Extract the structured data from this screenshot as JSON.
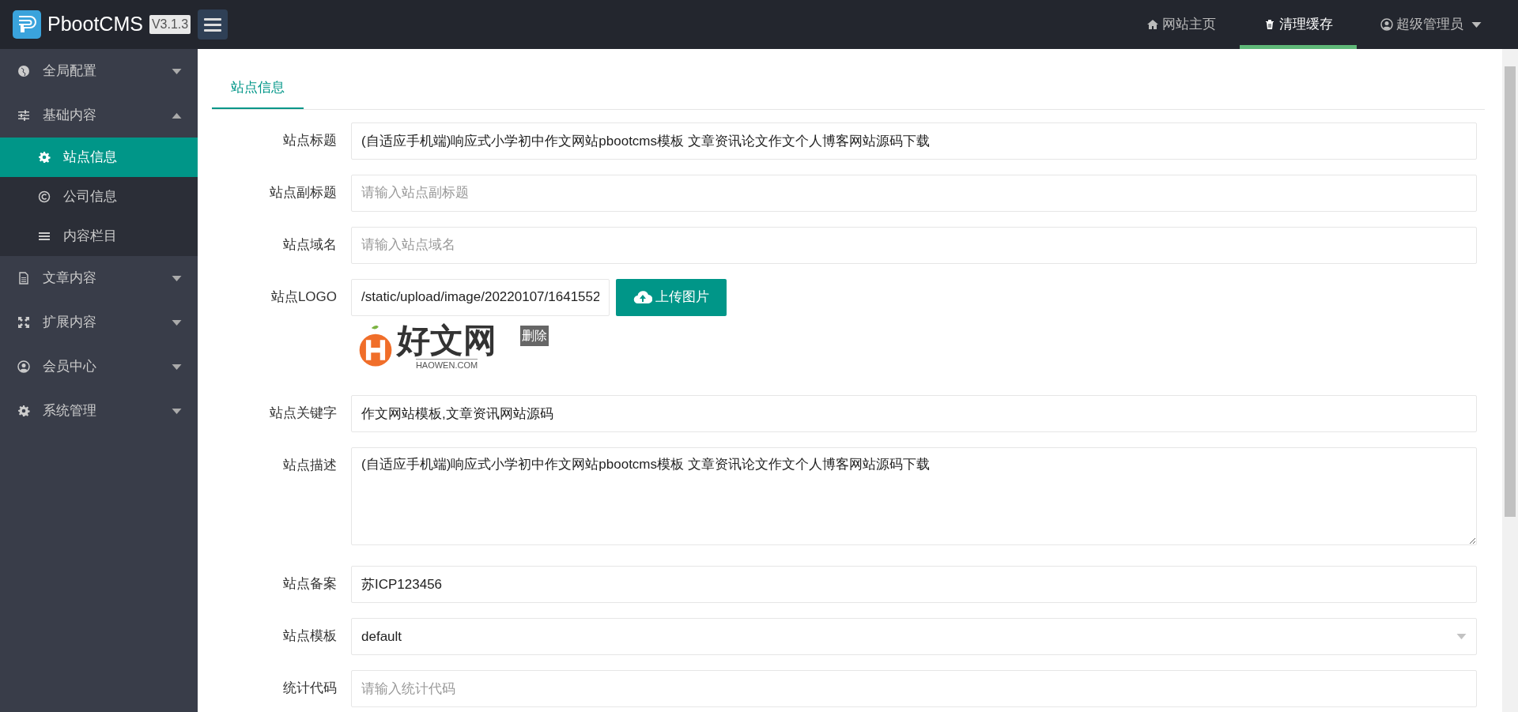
{
  "brand": {
    "name": "PbootCMS",
    "version": "V3.1.3"
  },
  "top_nav": [
    {
      "kind": "home",
      "label": "网站主页",
      "selected": false
    },
    {
      "kind": "trash",
      "label": "清理缓存",
      "selected": true
    },
    {
      "kind": "user",
      "label": "超级管理员",
      "dropdown": true,
      "selected": false
    }
  ],
  "sidebar": {
    "items": [
      {
        "kind": "globe",
        "label": "全局配置",
        "expanded": false
      },
      {
        "kind": "sliders",
        "label": "基础内容",
        "expanded": true,
        "children": [
          {
            "kind": "gear",
            "label": "站点信息",
            "selected": true
          },
          {
            "kind": "copyright",
            "label": "公司信息",
            "selected": false
          },
          {
            "kind": "bars",
            "label": "内容栏目",
            "selected": false
          }
        ]
      },
      {
        "kind": "file",
        "label": "文章内容",
        "expanded": false
      },
      {
        "kind": "expand",
        "label": "扩展内容",
        "expanded": false
      },
      {
        "kind": "user",
        "label": "会员中心",
        "expanded": false
      },
      {
        "kind": "gear",
        "label": "系统管理",
        "expanded": false
      }
    ]
  },
  "tabs": [
    {
      "label": "站点信息",
      "selected": true
    }
  ],
  "form": [
    {
      "kind": "text",
      "label": "站点标题",
      "value": "(自适应手机端)响应式小学初中作文网站pbootcms模板 文章资讯论文作文个人博客网站源码下载"
    },
    {
      "kind": "text",
      "label": "站点副标题",
      "placeholder": "请输入站点副标题"
    },
    {
      "kind": "text",
      "label": "站点域名",
      "placeholder": "请输入站点域名"
    },
    {
      "kind": "upload",
      "label": "站点LOGO",
      "value": "/static/upload/image/20220107/1641552",
      "button": "上传图片",
      "delete": "删除",
      "preview": {
        "title": "好文网",
        "subtitle": "HAOWEN.COM"
      }
    },
    {
      "kind": "text",
      "label": "站点关键字",
      "value": "作文网站模板,文章资讯网站源码"
    },
    {
      "kind": "textarea",
      "label": "站点描述",
      "value": "(自适应手机端)响应式小学初中作文网站pbootcms模板 文章资讯论文作文个人博客网站源码下载"
    },
    {
      "kind": "text",
      "label": "站点备案",
      "value": "苏ICP123456"
    },
    {
      "kind": "select",
      "label": "站点模板",
      "value": "default"
    },
    {
      "kind": "text",
      "label": "统计代码",
      "placeholder": "请输入统计代码"
    }
  ]
}
